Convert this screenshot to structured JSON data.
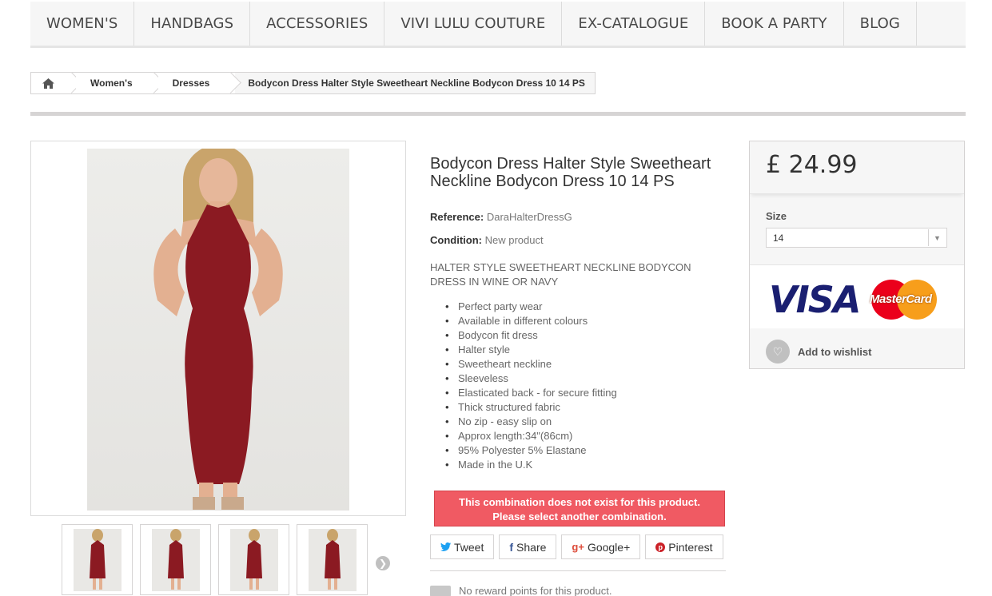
{
  "menu": {
    "items": [
      "WOMEN'S",
      "HANDBAGS",
      "ACCESSORIES",
      "VIVI LULU COUTURE",
      "EX-CATALOGUE",
      "BOOK A PARTY",
      "BLOG"
    ]
  },
  "breadcrumb": {
    "home_icon": "home-icon",
    "items": [
      "Women's",
      "Dresses"
    ],
    "current": "Bodycon Dress Halter Style Sweetheart Neckline Bodycon Dress 10 14 PS"
  },
  "product": {
    "title": "Bodycon Dress Halter Style Sweetheart Neckline Bodycon Dress 10 14 PS",
    "reference_label": "Reference:",
    "reference": "DaraHalterDressG",
    "condition_label": "Condition:",
    "condition": "New product",
    "short_description": "HALTER STYLE SWEETHEART NECKLINE BODYCON DRESS IN WINE OR NAVY",
    "features": [
      "Perfect party wear",
      "Available in different colours",
      "Bodycon fit dress",
      "Halter style",
      "Sweetheart neckline",
      "Sleeveless",
      "Elasticated back - for secure fitting",
      "Thick structured fabric",
      "No zip - easy slip on",
      "Approx length:34\"(86cm)",
      "95% Polyester 5% Elastane",
      "Made in the U.K"
    ],
    "dress_color": "#8b1a22"
  },
  "alert": {
    "line1": "This combination does not exist for this product.",
    "line2": "Please select another combination."
  },
  "social": {
    "tweet": "Tweet",
    "share": "Share",
    "google": "Google+",
    "pinterest": "Pinterest"
  },
  "reward": "No reward points for this product.",
  "buybox": {
    "price": "£ 24.99",
    "size_label": "Size",
    "size_value": "14",
    "visa_text": "VISA",
    "mastercard_text": "MasterCard",
    "wishlist": "Add to wishlist"
  }
}
